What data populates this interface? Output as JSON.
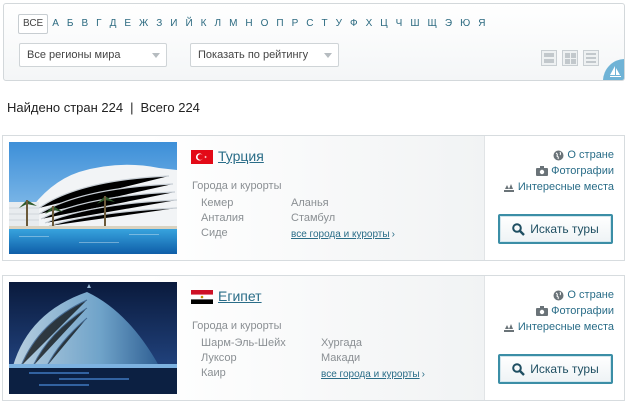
{
  "filter": {
    "letters": [
      "ВСЕ",
      "А",
      "Б",
      "В",
      "Г",
      "Д",
      "Е",
      "Ж",
      "З",
      "И",
      "Й",
      "К",
      "Л",
      "М",
      "Н",
      "О",
      "П",
      "Р",
      "С",
      "Т",
      "У",
      "Ф",
      "Х",
      "Ц",
      "Ч",
      "Ш",
      "Щ",
      "Э",
      "Ю",
      "Я"
    ],
    "active_letter": "ВСЕ",
    "region_select": "Все регионы мира",
    "sort_select": "Показать по рейтингу",
    "view_modes": [
      "list-view-icon",
      "grid-view-icon",
      "lines-view-icon"
    ]
  },
  "counts": {
    "found_label": "Найдено стран 224",
    "separator": "|",
    "total_label": "Всего 224"
  },
  "countries": [
    {
      "name": "Турция",
      "flag": "flag-turkey-icon",
      "resorts_title": "Города и курорты",
      "resorts": [
        "Кемер",
        "Аланья",
        "Анталия",
        "Стамбул",
        "Сиде"
      ],
      "all_link": "все города и курорты",
      "links": {
        "about": "О стране",
        "photos": "Фотографии",
        "places": "Интересные места"
      },
      "search_button": "Искать туры"
    },
    {
      "name": "Египет",
      "flag": "flag-egypt-icon",
      "resorts_title": "Города и курорты",
      "resorts": [
        "Шарм-Эль-Шейх",
        "Хургада",
        "Луксор",
        "Макади",
        "Каир"
      ],
      "all_link": "все города и курорты",
      "links": {
        "about": "О стране",
        "photos": "Фотографии",
        "places": "Интересные места"
      },
      "search_button": "Искать туры"
    }
  ],
  "colors": {
    "link": "#2a6d88",
    "button_border": "#3b8ea6",
    "badge": "#6fb3d6"
  }
}
